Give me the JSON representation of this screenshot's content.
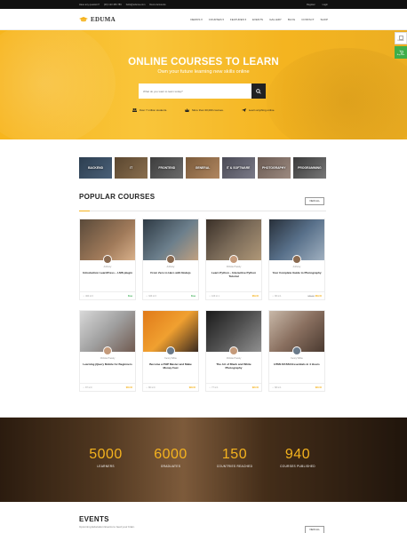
{
  "topbar": {
    "question": "Have any question?",
    "phone": "(00) 123 456 789",
    "email": "hello@eduma.com",
    "account": "Demo Accounts",
    "register": "Register",
    "login": "Login"
  },
  "nav": {
    "logo": "EDUMA",
    "menu": [
      "DEMOS ▾",
      "COURSES ▾",
      "FEATURES ▾",
      "EVENTS",
      "GALLERY",
      "BLOG",
      "CONTACT",
      "SHOP"
    ]
  },
  "hero": {
    "title": "ONLINE COURSES TO LEARN",
    "subtitle": "Own your future learning new skills online",
    "search_placeholder": "What do you want to learn today?",
    "features": [
      "Over 7 million students.",
      "More than 30,000 courses.",
      "Learn anything online."
    ]
  },
  "side_buttons": [
    "Demos",
    "Buy now"
  ],
  "categories": [
    "BACKEND",
    "IT",
    "FRONTEND",
    "GENERAL",
    "IT & SOFTWARE",
    "PHOTOGRAPHY",
    "PROGRAMMING"
  ],
  "popular": {
    "title": "POPULAR COURSES",
    "view_all": "VIEW ALL",
    "courses": [
      {
        "author": "Anthony",
        "title": "Introduction LearnPress – LMS plugin",
        "students": "464",
        "comments": "0",
        "old_price": "",
        "price": "Free"
      },
      {
        "author": "Anthony",
        "title": "From Zero to Hero with Nodejs",
        "students": "323",
        "comments": "0",
        "old_price": "",
        "price": "Free"
      },
      {
        "author": "Christie Pressly",
        "title": "Learn Python – Interactive Python Tutorial",
        "students": "103",
        "comments": "1",
        "old_price": "",
        "price": "$69.00"
      },
      {
        "author": "Anthony",
        "title": "Your Complete Guide to Photography",
        "students": "96",
        "comments": "1",
        "old_price": "$80.00",
        "price": "$69.00"
      },
      {
        "author": "Christie Pressly",
        "title": "Learning jQuery Mobile for Beginners",
        "students": "87",
        "comments": "0",
        "old_price": "",
        "price": "$30.00"
      },
      {
        "author": "Kenny White",
        "title": "Become a PHP Master and Make Money Fast",
        "students": "80",
        "comments": "0",
        "old_price": "",
        "price": "$99.00"
      },
      {
        "author": "Christie Pressly",
        "title": "The Art of Black and White Photography",
        "students": "77",
        "comments": "1",
        "old_price": "",
        "price": "$90.00"
      },
      {
        "author": "Kenny White",
        "title": "HTML5/CSS3 Essentials in 4 Hours",
        "students": "68",
        "comments": "1",
        "old_price": "",
        "price": "$90.00"
      }
    ]
  },
  "stats": [
    {
      "number": "5000",
      "label": "LEARNERS"
    },
    {
      "number": "6000",
      "label": "GRADUATES"
    },
    {
      "number": "150",
      "label": "COUNTRIES REACHED"
    },
    {
      "number": "940",
      "label": "COURSES PUBLISHED"
    }
  ],
  "events": {
    "title": "EVENTS",
    "subtitle": "Upcoming Education Events to feed your brain.",
    "view_all": "VIEW ALL"
  },
  "colors": {
    "accent": "#f5b31e",
    "dark": "#111111",
    "green": "#3fae4a"
  }
}
